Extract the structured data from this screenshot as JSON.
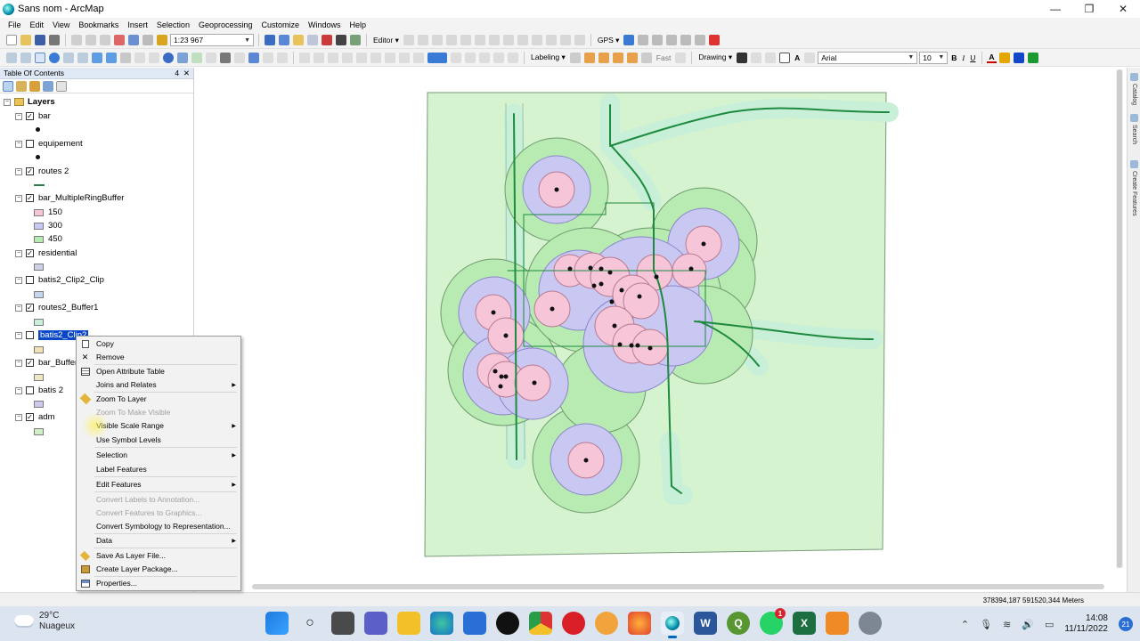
{
  "window": {
    "title": "Sans nom - ArcMap",
    "controls": [
      "—",
      "❐",
      "✕"
    ]
  },
  "menu": [
    "File",
    "Edit",
    "View",
    "Bookmarks",
    "Insert",
    "Selection",
    "Geoprocessing",
    "Customize",
    "Windows",
    "Help"
  ],
  "toolbar1": {
    "scale": "1:23 967",
    "editor": "Editor ▾",
    "gps": "GPS ▾"
  },
  "toolbar2": {
    "labeling": "Labeling ▾",
    "fast": "Fast",
    "drawing": "Drawing ▾",
    "font": "Arial",
    "size": "10",
    "bold": "B",
    "italic": "I",
    "underline": "U",
    "font_color": "A"
  },
  "toc": {
    "title": "Table Of Contents",
    "head_icons": [
      "4",
      "✕"
    ],
    "root": "Layers",
    "layers": [
      {
        "name": "bar",
        "checked": true
      },
      {
        "name": "equipement",
        "checked": false
      },
      {
        "name": "routes 2",
        "checked": true
      },
      {
        "name": "bar_MultipleRingBuffer",
        "checked": true,
        "classes": [
          "150",
          "300",
          "450"
        ]
      },
      {
        "name": "residential",
        "checked": true
      },
      {
        "name": "batis2_Clip2_Clip",
        "checked": false
      },
      {
        "name": "routes2_Buffer1",
        "checked": true
      },
      {
        "name": "batis2_Clip2",
        "checked": false
      },
      {
        "name": "bar_Buffer",
        "checked": true
      },
      {
        "name": "batis 2",
        "checked": false
      },
      {
        "name": "adm",
        "checked": true
      }
    ],
    "selected": "batis2_Clip2"
  },
  "context_menu": {
    "items": [
      {
        "label": "Copy",
        "icon": "copy-icon",
        "enabled": true
      },
      {
        "label": "Remove",
        "icon": "remove-icon",
        "enabled": true
      },
      {
        "label": "Open Attribute Table",
        "icon": "table-icon",
        "enabled": true
      },
      {
        "label": "Joins and Relates",
        "enabled": true,
        "submenu": true
      },
      {
        "label": "Zoom To Layer",
        "icon": "zoom-layer-icon",
        "enabled": true
      },
      {
        "label": "Zoom To Make Visible",
        "enabled": false
      },
      {
        "label": "Visible Scale Range",
        "enabled": true,
        "submenu": true
      },
      {
        "label": "Use Symbol Levels",
        "enabled": true
      },
      {
        "label": "Selection",
        "enabled": true,
        "submenu": true
      },
      {
        "label": "Label Features",
        "enabled": true
      },
      {
        "label": "Edit Features",
        "enabled": true,
        "submenu": true
      },
      {
        "label": "Convert Labels to Annotation...",
        "enabled": false
      },
      {
        "label": "Convert Features to Graphics...",
        "enabled": false
      },
      {
        "label": "Convert Symbology to Representation...",
        "enabled": true
      },
      {
        "label": "Data",
        "enabled": true,
        "submenu": true
      },
      {
        "label": "Save As Layer File...",
        "icon": "layer-file-icon",
        "enabled": true
      },
      {
        "label": "Create Layer Package...",
        "icon": "package-icon",
        "enabled": true
      },
      {
        "label": "Properties...",
        "icon": "properties-icon",
        "enabled": true
      }
    ],
    "submenu_arrow": "▶"
  },
  "right_dock": {
    "tabs": [
      "Catalog",
      "Search",
      "Create Features"
    ]
  },
  "status": {
    "coordinates": "378394,187  591520,344 Meters"
  },
  "colors": {
    "ring150": "#f6c6d8",
    "ring300": "#c9c8f3",
    "ring450": "#b7ebb2",
    "adm": "#d6f3cf",
    "roads": "#1d8a3e",
    "road_buffer": "#c8efd8"
  },
  "taskbar": {
    "weather_temp": "29°C",
    "weather_desc": "Nuageux",
    "time": "14:08",
    "date": "11/11/2022",
    "notification_count": "21",
    "whatsapp_badge": "1"
  }
}
